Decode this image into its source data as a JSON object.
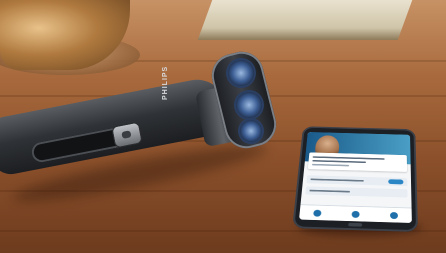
{
  "scene": {
    "brand_text": "PHILIPS"
  },
  "colors": {
    "wood": "#9a5e34",
    "shaver_body": "#2f3236",
    "shaver_blade_blue": "#3d5f95",
    "phone_app_header": "#2b86c5"
  },
  "icons": [
    "power-button-icon",
    "app-tab-icon"
  ]
}
